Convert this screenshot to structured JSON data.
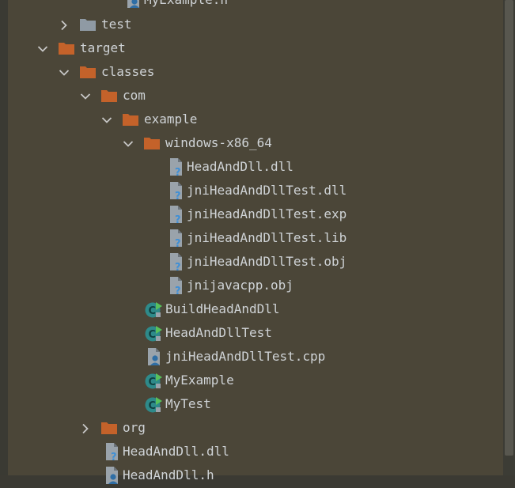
{
  "tree": {
    "items": [
      {
        "label": "MyExample.h",
        "icon": "header-file-icon",
        "arrow": "none",
        "folder_color": ""
      },
      {
        "label": "test",
        "icon": "folder-icon",
        "arrow": "collapsed",
        "folder_color": "#8f9aa4"
      },
      {
        "label": "target",
        "icon": "folder-icon",
        "arrow": "expanded",
        "folder_color": "#c4622a"
      },
      {
        "label": "classes",
        "icon": "folder-icon",
        "arrow": "expanded",
        "folder_color": "#c4622a"
      },
      {
        "label": "com",
        "icon": "folder-icon",
        "arrow": "expanded",
        "folder_color": "#c4622a"
      },
      {
        "label": "example",
        "icon": "folder-icon",
        "arrow": "expanded",
        "folder_color": "#c4622a"
      },
      {
        "label": "windows-x86_64",
        "icon": "folder-icon",
        "arrow": "expanded",
        "folder_color": "#c4622a"
      },
      {
        "label": "HeadAndDll.dll",
        "icon": "unknown-file-icon",
        "arrow": "none",
        "folder_color": ""
      },
      {
        "label": "jniHeadAndDllTest.dll",
        "icon": "unknown-file-icon",
        "arrow": "none",
        "folder_color": ""
      },
      {
        "label": "jniHeadAndDllTest.exp",
        "icon": "unknown-file-icon",
        "arrow": "none",
        "folder_color": ""
      },
      {
        "label": "jniHeadAndDllTest.lib",
        "icon": "unknown-file-icon",
        "arrow": "none",
        "folder_color": ""
      },
      {
        "label": "jniHeadAndDllTest.obj",
        "icon": "unknown-file-icon",
        "arrow": "none",
        "folder_color": ""
      },
      {
        "label": "jnijavacpp.obj",
        "icon": "unknown-file-icon",
        "arrow": "none",
        "folder_color": ""
      },
      {
        "label": "BuildHeadAndDll",
        "icon": "class-icon",
        "arrow": "none",
        "folder_color": ""
      },
      {
        "label": "HeadAndDllTest",
        "icon": "class-icon",
        "arrow": "none",
        "folder_color": ""
      },
      {
        "label": "jniHeadAndDllTest.cpp",
        "icon": "cpp-file-icon",
        "arrow": "none",
        "folder_color": ""
      },
      {
        "label": "MyExample",
        "icon": "class-icon",
        "arrow": "none",
        "folder_color": ""
      },
      {
        "label": "MyTest",
        "icon": "class-icon",
        "arrow": "none",
        "folder_color": ""
      },
      {
        "label": "org",
        "icon": "folder-icon",
        "arrow": "collapsed",
        "folder_color": "#c4622a"
      },
      {
        "label": "HeadAndDll.dll",
        "icon": "unknown-file-icon",
        "arrow": "none",
        "folder_color": ""
      },
      {
        "label": "HeadAndDll.h",
        "icon": "header-file-icon",
        "arrow": "none",
        "folder_color": ""
      }
    ]
  },
  "colors": {
    "panel_bg": "#4b4638",
    "text": "#cfd3d6",
    "arrow": "#c7c7c7",
    "folder_orange": "#c4622a",
    "folder_gray": "#8f9aa4",
    "file_gray": "#9aa3ab",
    "question_blue": "#3e8fd6",
    "class_teal": "#2e8a8a",
    "run_green": "#58c15c"
  }
}
